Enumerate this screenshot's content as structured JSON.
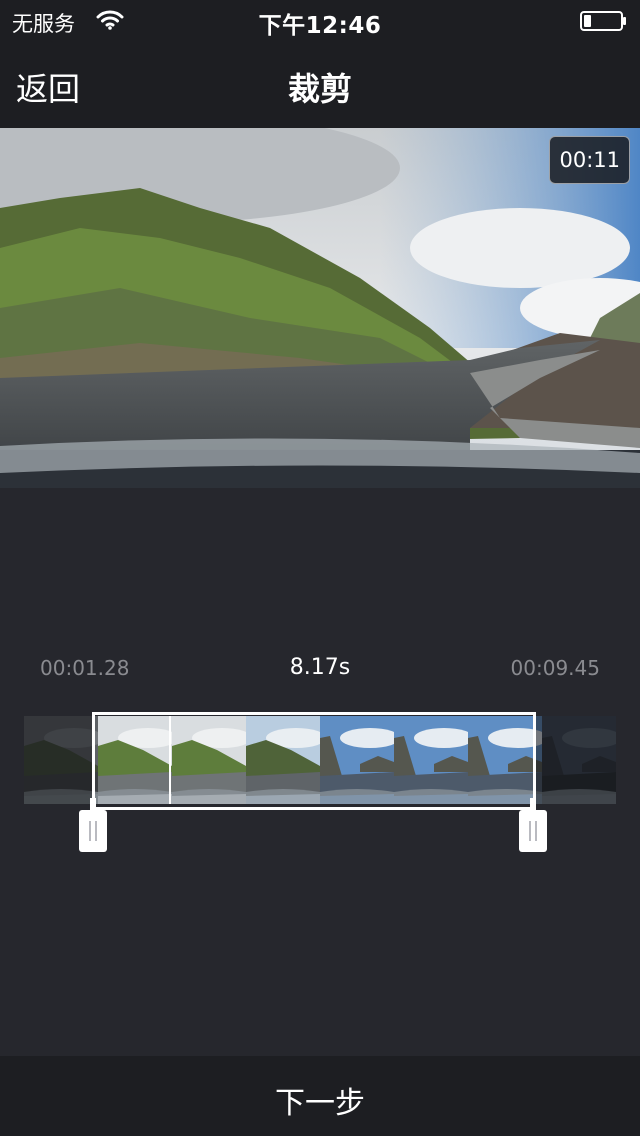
{
  "status_bar": {
    "carrier": "无服务",
    "time": "下午12:46",
    "battery_level": 0.2
  },
  "nav": {
    "back_label": "返回",
    "title": "裁剪"
  },
  "video": {
    "time_badge": "00:11"
  },
  "trim": {
    "start": "00:01.28",
    "duration": "8.17s",
    "end": "00:09.45"
  },
  "filmstrip": {
    "frames": [
      {
        "scene": "dark-hills"
      },
      {
        "scene": "green-hills"
      },
      {
        "scene": "green-hills"
      },
      {
        "scene": "road-curve"
      },
      {
        "scene": "mountain-sky"
      },
      {
        "scene": "mountain-sky"
      },
      {
        "scene": "mountain-sky"
      },
      {
        "scene": "dark-mountain"
      }
    ]
  },
  "footer": {
    "next_label": "下一步"
  },
  "colors": {
    "background": "#26272d",
    "bar": "#1d1e22",
    "muted_text": "#8a8b90",
    "selection": "#ffffff"
  }
}
